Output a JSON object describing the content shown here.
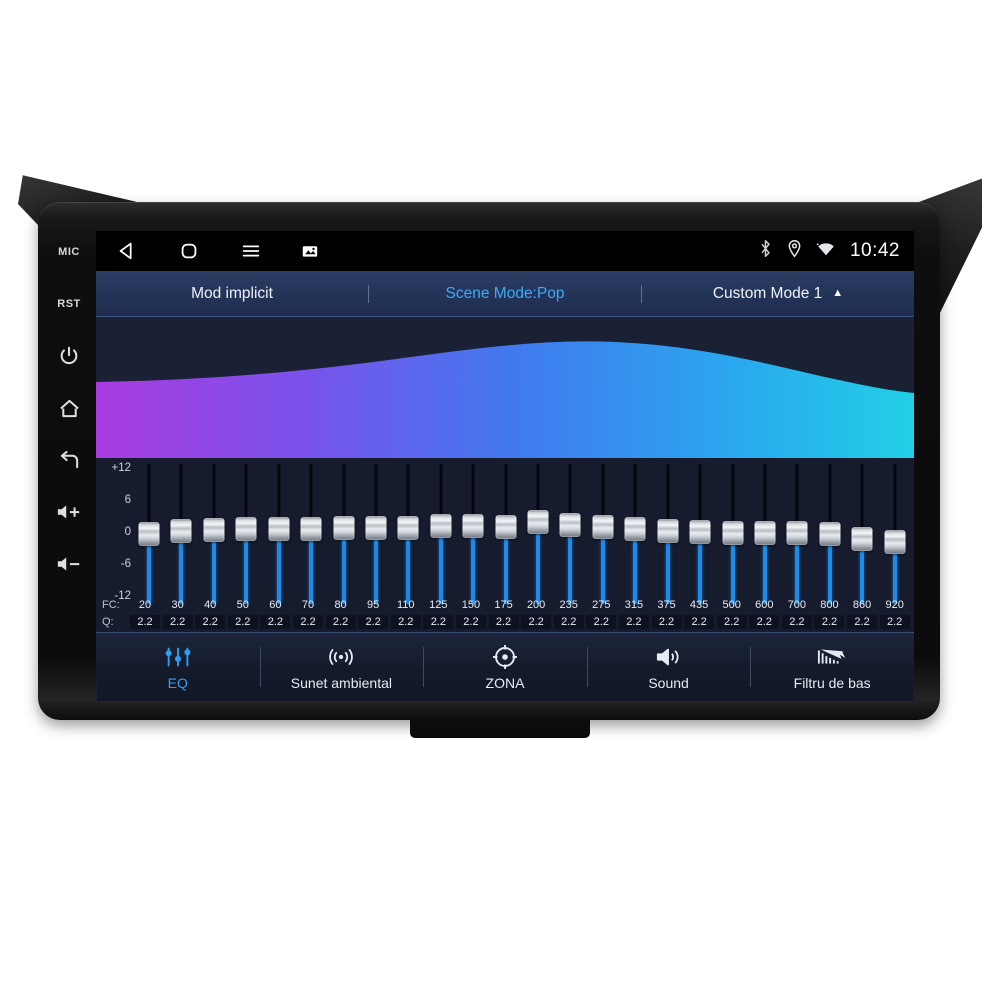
{
  "device": {
    "name": "car-head-unit",
    "hardware_keys": [
      {
        "id": "mic",
        "label": "MIC",
        "icon": "mic-label"
      },
      {
        "id": "rst",
        "label": "RST",
        "icon": "reset-label"
      },
      {
        "id": "power",
        "label": "",
        "icon": "power-icon"
      },
      {
        "id": "home",
        "label": "",
        "icon": "home-icon"
      },
      {
        "id": "back",
        "label": "",
        "icon": "back-arrow-icon"
      },
      {
        "id": "volume-up",
        "label": "",
        "icon": "volume-up-icon"
      },
      {
        "id": "volume-down",
        "label": "",
        "icon": "volume-down-icon"
      }
    ]
  },
  "statusbar": {
    "nav": [
      {
        "id": "back",
        "icon": "back-triangle-icon"
      },
      {
        "id": "home",
        "icon": "home-square-icon"
      },
      {
        "id": "menu",
        "icon": "hamburger-menu-icon"
      },
      {
        "id": "screenshot",
        "icon": "screenshot-icon"
      }
    ],
    "indicators": [
      {
        "id": "bluetooth",
        "icon": "bluetooth-icon"
      },
      {
        "id": "location",
        "icon": "location-pin-icon"
      },
      {
        "id": "wifi",
        "icon": "wifi-icon"
      }
    ],
    "clock": "10:42"
  },
  "mode_row": {
    "default_mode": "Mod implicit",
    "scene_mode": "Scene Mode:Pop",
    "custom_mode": "Custom Mode 1",
    "expand_icon": "caret-up-icon",
    "accent_color": "#3fa9f5"
  },
  "spectrum": {
    "gradient_stops": [
      "#a93ce0",
      "#7b52ea",
      "#3f7bef",
      "#2aa8ee",
      "#22cfe6"
    ],
    "background": "#1b2135"
  },
  "equalizer": {
    "scale_labels": [
      "+12",
      "6",
      "0",
      "-6",
      "-12"
    ],
    "fc_label": "FC:",
    "q_label": "Q:",
    "db_range": [
      -12,
      12
    ],
    "bands": [
      {
        "fc": "20",
        "q": "2.2",
        "gain": 0.0
      },
      {
        "fc": "30",
        "q": "2.2",
        "gain": 0.6
      },
      {
        "fc": "40",
        "q": "2.2",
        "gain": 0.8
      },
      {
        "fc": "50",
        "q": "2.2",
        "gain": 1.1
      },
      {
        "fc": "60",
        "q": "2.2",
        "gain": 1.0
      },
      {
        "fc": "70",
        "q": "2.2",
        "gain": 1.1
      },
      {
        "fc": "80",
        "q": "2.2",
        "gain": 1.2
      },
      {
        "fc": "95",
        "q": "2.2",
        "gain": 1.2
      },
      {
        "fc": "110",
        "q": "2.2",
        "gain": 1.2
      },
      {
        "fc": "125",
        "q": "2.2",
        "gain": 1.6
      },
      {
        "fc": "150",
        "q": "2.2",
        "gain": 1.6
      },
      {
        "fc": "175",
        "q": "2.2",
        "gain": 1.5
      },
      {
        "fc": "200",
        "q": "2.2",
        "gain": 2.4
      },
      {
        "fc": "235",
        "q": "2.2",
        "gain": 1.9
      },
      {
        "fc": "275",
        "q": "2.2",
        "gain": 1.5
      },
      {
        "fc": "315",
        "q": "2.2",
        "gain": 1.0
      },
      {
        "fc": "375",
        "q": "2.2",
        "gain": 0.7
      },
      {
        "fc": "435",
        "q": "2.2",
        "gain": 0.4
      },
      {
        "fc": "500",
        "q": "2.2",
        "gain": 0.2
      },
      {
        "fc": "600",
        "q": "2.2",
        "gain": 0.2
      },
      {
        "fc": "700",
        "q": "2.2",
        "gain": 0.2
      },
      {
        "fc": "800",
        "q": "2.2",
        "gain": 0.0
      },
      {
        "fc": "860",
        "q": "2.2",
        "gain": -1.0
      },
      {
        "fc": "920",
        "q": "2.2",
        "gain": -1.6
      }
    ]
  },
  "tabbar": {
    "active": "EQ",
    "items": [
      {
        "label": "EQ",
        "icon": "equalizer-sliders-icon",
        "active": true
      },
      {
        "label": "Sunet ambiental",
        "icon": "surround-waves-icon",
        "active": false
      },
      {
        "label": "ZONA",
        "icon": "zone-crosshair-icon",
        "active": false
      },
      {
        "label": "Sound",
        "icon": "speaker-icon",
        "active": false
      },
      {
        "label": "Filtru de bas",
        "icon": "bass-filter-icon",
        "active": false
      }
    ]
  }
}
